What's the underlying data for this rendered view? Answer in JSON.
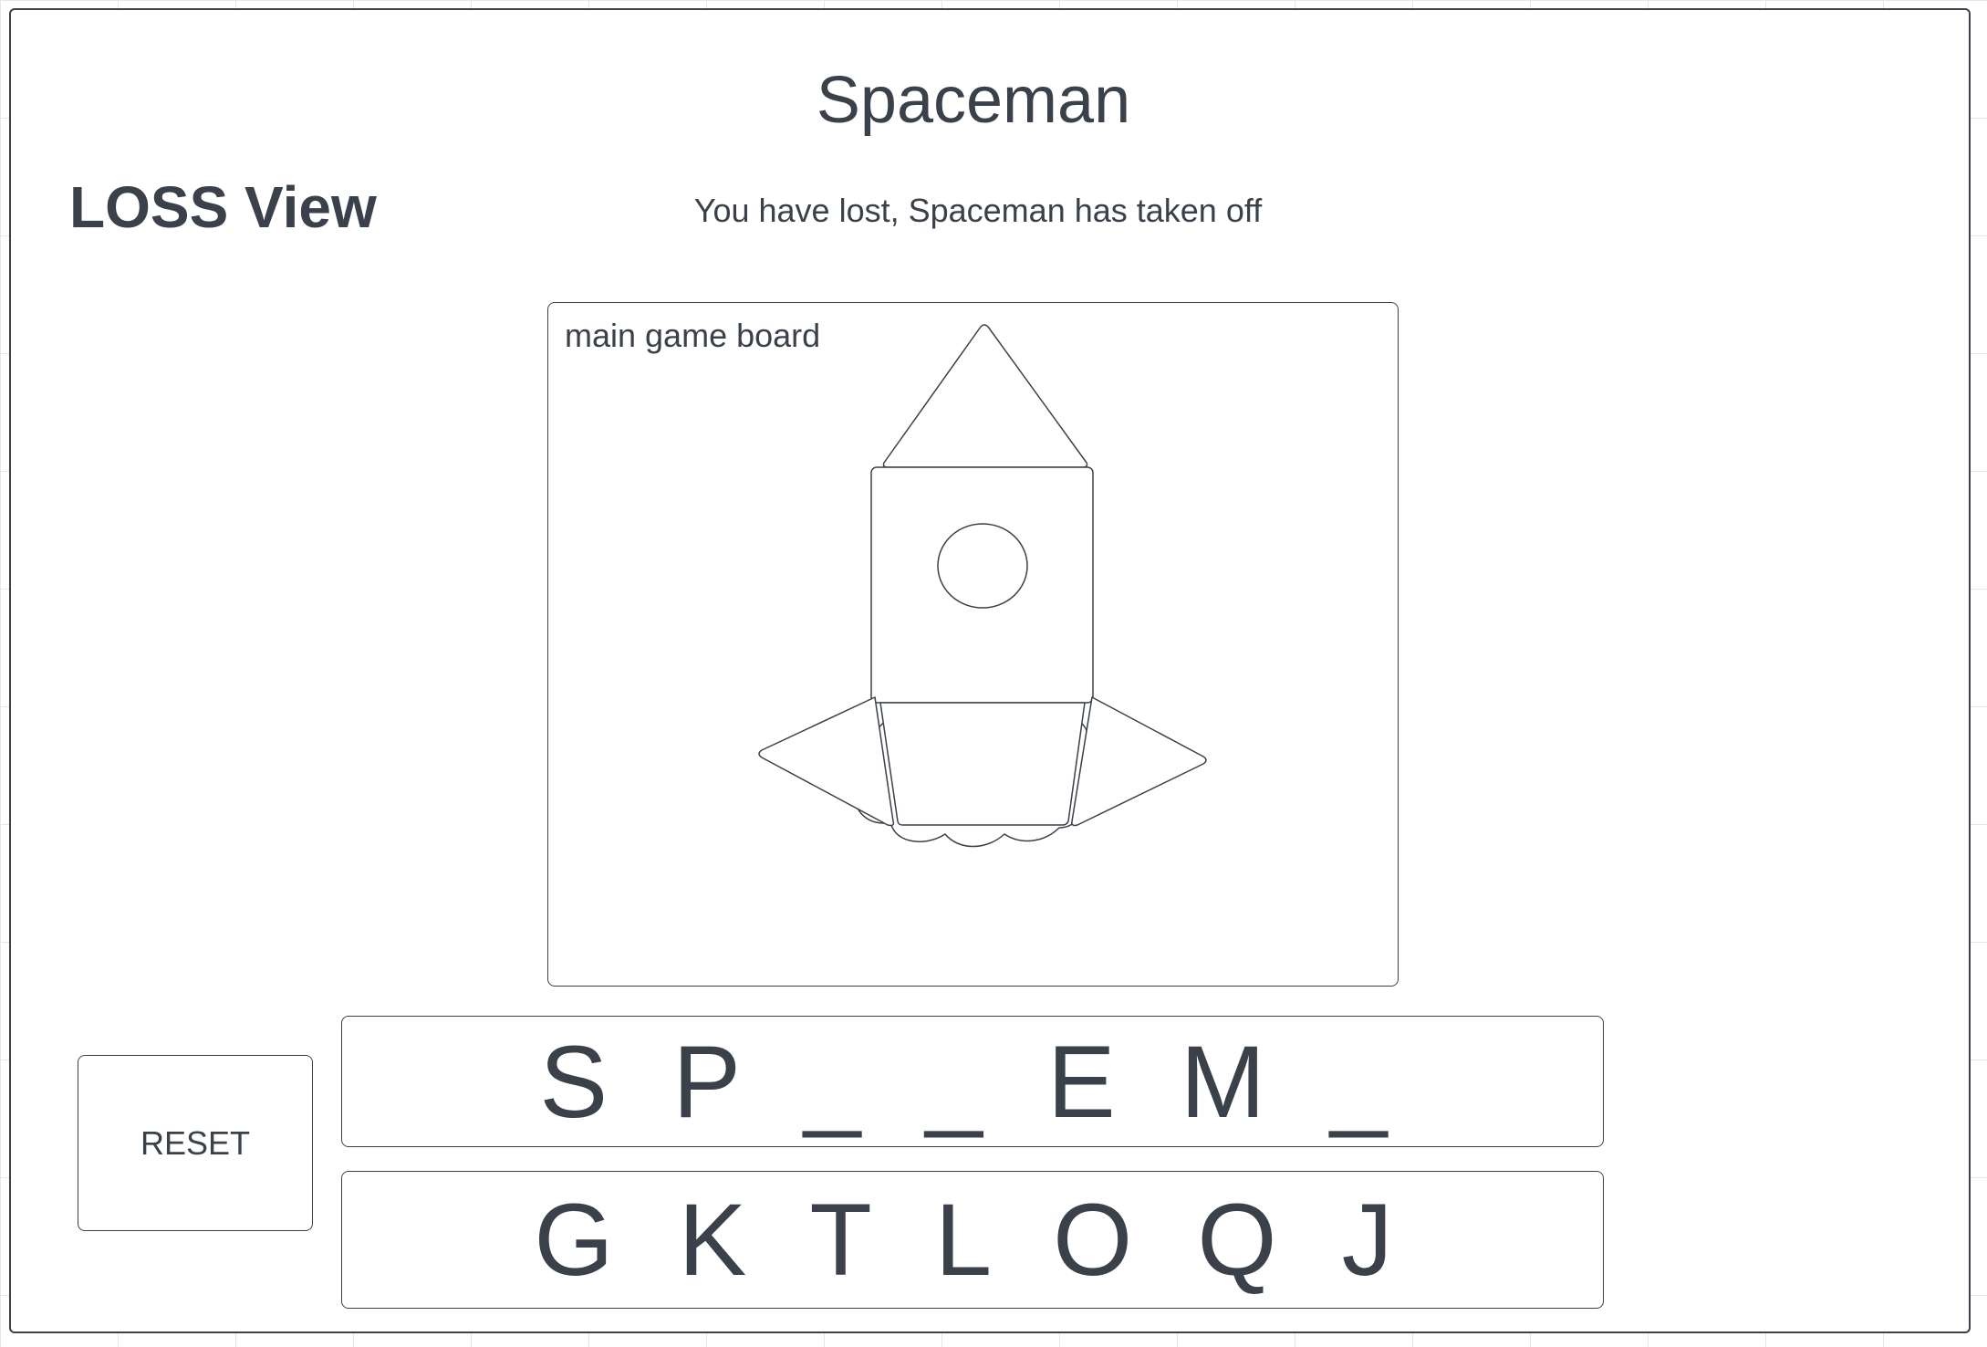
{
  "app": {
    "title": "Spaceman"
  },
  "view": {
    "label": "LOSS View",
    "message": "You have lost, Spaceman has taken off"
  },
  "board": {
    "label": "main game board"
  },
  "controls": {
    "reset_label": "RESET"
  },
  "word": {
    "display": "S P _ _ E M _"
  },
  "guessed_letters": {
    "display": "G K T L O Q J"
  },
  "colors": {
    "text": "#3a414a",
    "border": "#3a414a",
    "background": "#ffffff",
    "grid": "#e6e6e6"
  },
  "icons": {
    "rocket": "rocket-icon",
    "exhaust": "exhaust-cloud-icon"
  }
}
